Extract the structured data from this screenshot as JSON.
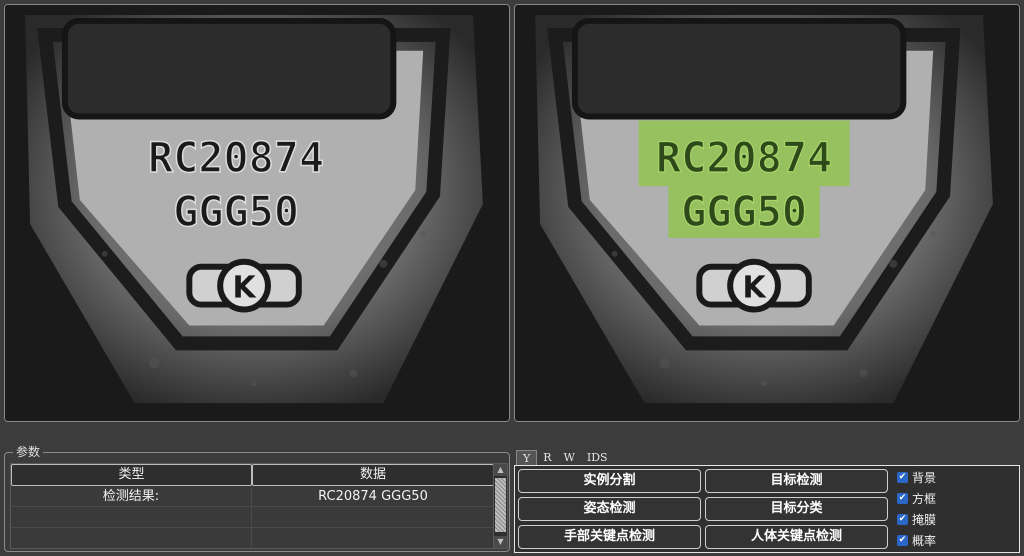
{
  "params": {
    "legend": "参数",
    "headers": [
      "类型",
      "数据"
    ],
    "rows": [
      {
        "type": "检测结果:",
        "value": "RC20874 GGG50"
      },
      {
        "type": "",
        "value": ""
      },
      {
        "type": "",
        "value": ""
      }
    ]
  },
  "image": {
    "code_line1": "RC20874",
    "code_line2": "GGG50",
    "logo_letter": "K"
  },
  "tabs": [
    "Y",
    "R",
    "W",
    "IDS"
  ],
  "active_tab": "Y",
  "buttons": [
    [
      "实例分割",
      "目标检测"
    ],
    [
      "姿态检测",
      "目标分类"
    ],
    [
      "手部关键点检测",
      "人体关键点检测"
    ]
  ],
  "checkboxes": [
    {
      "label": "背景",
      "checked": true
    },
    {
      "label": "方框",
      "checked": true
    },
    {
      "label": "掩膜",
      "checked": true
    },
    {
      "label": "概率",
      "checked": true
    }
  ],
  "colors": {
    "mask_overlay": "#8ec63f",
    "checkbox": "#2a67c8"
  }
}
